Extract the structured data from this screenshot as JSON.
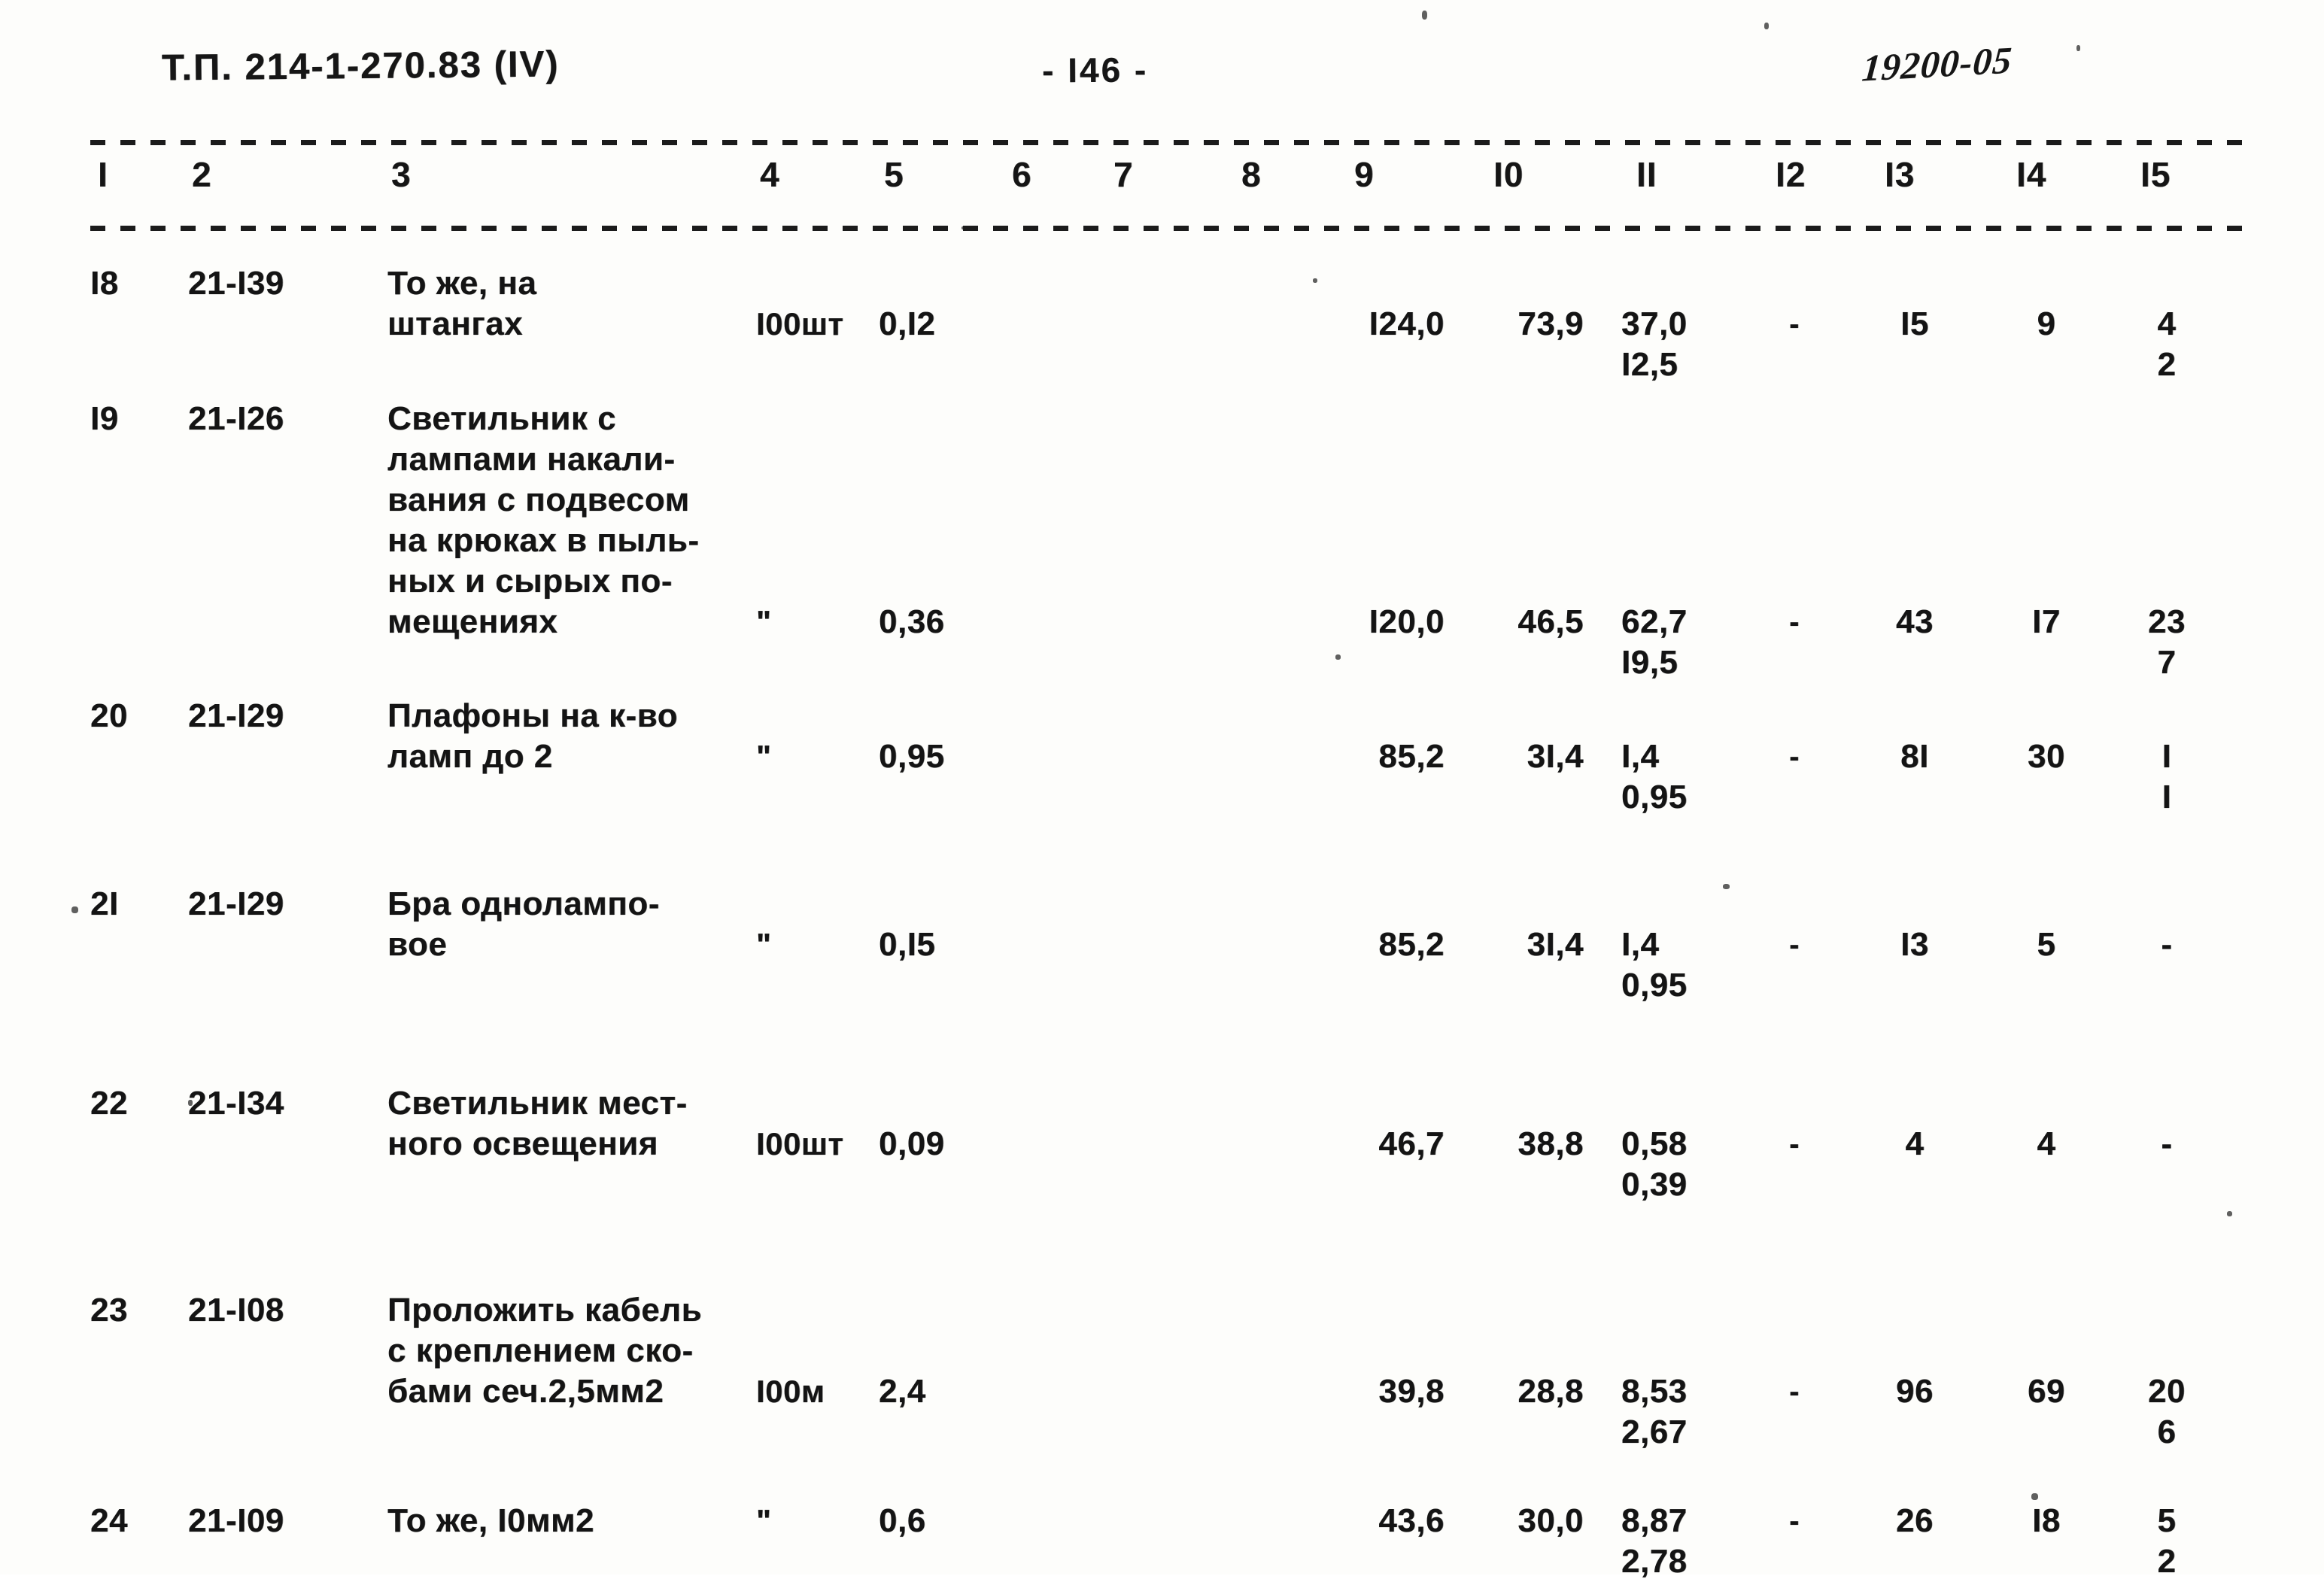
{
  "header": {
    "document_code": "Т.П. 214-1-270.83 (IV)",
    "page_number": "- I46 -",
    "stamp_code": "19200-05"
  },
  "table": {
    "column_numbers": [
      "I",
      "2",
      "3",
      "4",
      "5",
      "6",
      "7",
      "8",
      "9",
      "I0",
      "II",
      "I2",
      "I3",
      "I4",
      "I5"
    ],
    "rows": [
      {
        "num": "I8",
        "code": "21-I39",
        "desc_lines": [
          "То же, на",
          "штангах"
        ],
        "unit": "I00шт",
        "qty": "0,I2",
        "c9": "I24,0",
        "c10": "73,9",
        "c11_top": "37,0",
        "c11_bot": "I2,5",
        "c12": "-",
        "c13": "I5",
        "c14": "9",
        "c15_top": "4",
        "c15_bot": "2"
      },
      {
        "num": "I9",
        "code": "21-I26",
        "desc_lines": [
          "Светильник с",
          "лампами накали-",
          "вания с подвесом",
          "на крюках в пыль-",
          "ных и сырых по-",
          "мещениях"
        ],
        "unit": "\"",
        "qty": "0,36",
        "c9": "I20,0",
        "c10": "46,5",
        "c11_top": "62,7",
        "c11_bot": "I9,5",
        "c12": "-",
        "c13": "43",
        "c14": "I7",
        "c15_top": "23",
        "c15_bot": "7"
      },
      {
        "num": "20",
        "code": "21-I29",
        "desc_lines": [
          "Плафоны на к-во",
          "ламп до 2"
        ],
        "unit": "\"",
        "qty": "0,95",
        "c9": "85,2",
        "c10": "3I,4",
        "c11_top": "I,4",
        "c11_bot": "0,95",
        "c12": "-",
        "c13": "8I",
        "c14": "30",
        "c15_top": "I",
        "c15_bot": "I"
      },
      {
        "num": "2I",
        "code": "21-I29",
        "desc_lines": [
          "Бра однолампо-",
          "вое"
        ],
        "unit": "\"",
        "qty": "0,I5",
        "c9": "85,2",
        "c10": "3I,4",
        "c11_top": "I,4",
        "c11_bot": "0,95",
        "c12": "-",
        "c13": "I3",
        "c14": "5",
        "c15_top": "-",
        "c15_bot": ""
      },
      {
        "num": "22",
        "code": "21-I34",
        "desc_lines": [
          "Светильник мест-",
          "ного освещения"
        ],
        "unit": "I00шт",
        "qty": "0,09",
        "c9": "46,7",
        "c10": "38,8",
        "c11_top": "0,58",
        "c11_bot": "0,39",
        "c12": "-",
        "c13": "4",
        "c14": "4",
        "c15_top": "-",
        "c15_bot": ""
      },
      {
        "num": "23",
        "code": "21-I08",
        "desc_lines": [
          "Проложить кабель",
          "с креплением ско-",
          "бами сеч.2,5мм2"
        ],
        "unit": "I00м",
        "qty": "2,4",
        "c9": "39,8",
        "c10": "28,8",
        "c11_top": "8,53",
        "c11_bot": "2,67",
        "c12": "-",
        "c13": "96",
        "c14": "69",
        "c15_top": "20",
        "c15_bot": "6"
      },
      {
        "num": "24",
        "code": "21-I09",
        "desc_lines": [
          "То же, I0мм2"
        ],
        "unit": "\"",
        "qty": "0,6",
        "c9": "43,6",
        "c10": "30,0",
        "c11_top": "8,87",
        "c11_bot": "2,78",
        "c12": "-",
        "c13": "26",
        "c14": "I8",
        "c15_top": "5",
        "c15_bot": "2"
      }
    ]
  }
}
